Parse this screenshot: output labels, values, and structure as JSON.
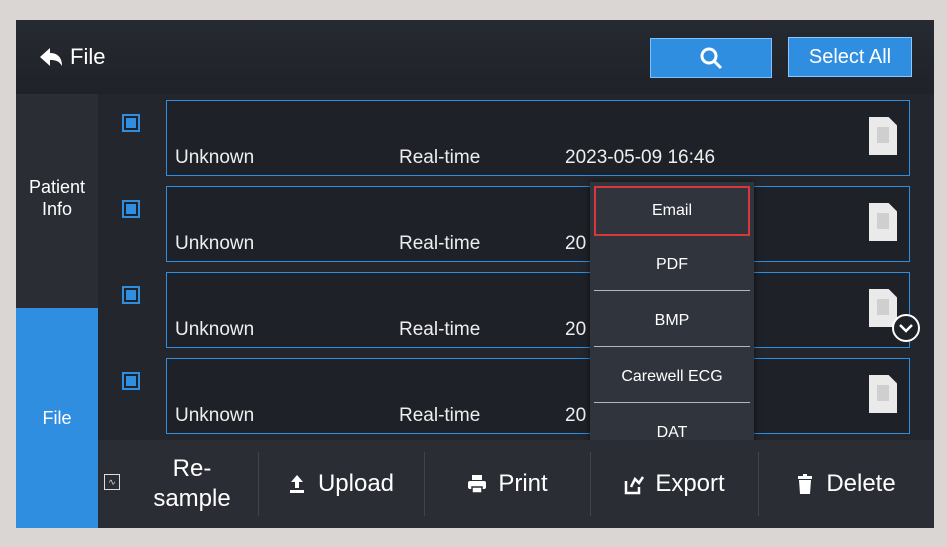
{
  "header": {
    "back_label": "File",
    "select_all_label": "Select All"
  },
  "sidebar": {
    "tabs": [
      {
        "label": "Patient\nInfo"
      },
      {
        "label": "File"
      }
    ]
  },
  "files": [
    {
      "name": "Unknown",
      "type": "Real-time",
      "date": "2023-05-09 16:46"
    },
    {
      "name": "Unknown",
      "type": "Real-time",
      "date": "20"
    },
    {
      "name": "Unknown",
      "type": "Real-time",
      "date": "20"
    },
    {
      "name": "Unknown",
      "type": "Real-time",
      "date": "20"
    }
  ],
  "export_menu": {
    "items": [
      "Email",
      "PDF",
      "BMP",
      "Carewell ECG",
      "DAT"
    ],
    "selected": "Email"
  },
  "toolbar": {
    "resample_label": "Re-\nsample",
    "upload_label": "Upload",
    "print_label": "Print",
    "export_label": "Export",
    "delete_label": "Delete"
  },
  "colors": {
    "accent": "#2f8ee0",
    "selected_border": "#d9373b",
    "background": "#23262d"
  }
}
